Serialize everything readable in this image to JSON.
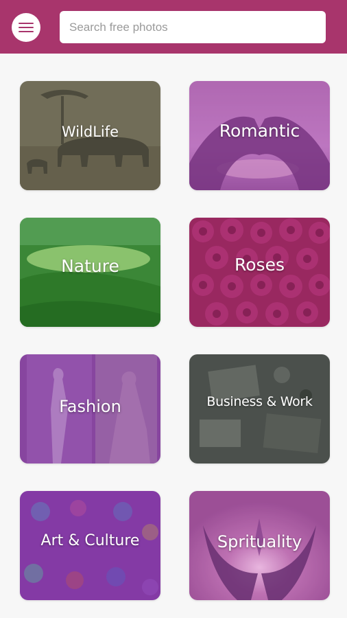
{
  "header": {
    "search_placeholder": "Search free photos",
    "menu_icon": "hamburger-menu-icon",
    "background_color": "#a8356c"
  },
  "categories": [
    {
      "label": "WildLife"
    },
    {
      "label": "Romantic"
    },
    {
      "label": "Nature"
    },
    {
      "label": "Roses"
    },
    {
      "label": "Fashion"
    },
    {
      "label": "Business & Work"
    },
    {
      "label": "Art & Culture"
    },
    {
      "label": "Sprituality"
    }
  ]
}
